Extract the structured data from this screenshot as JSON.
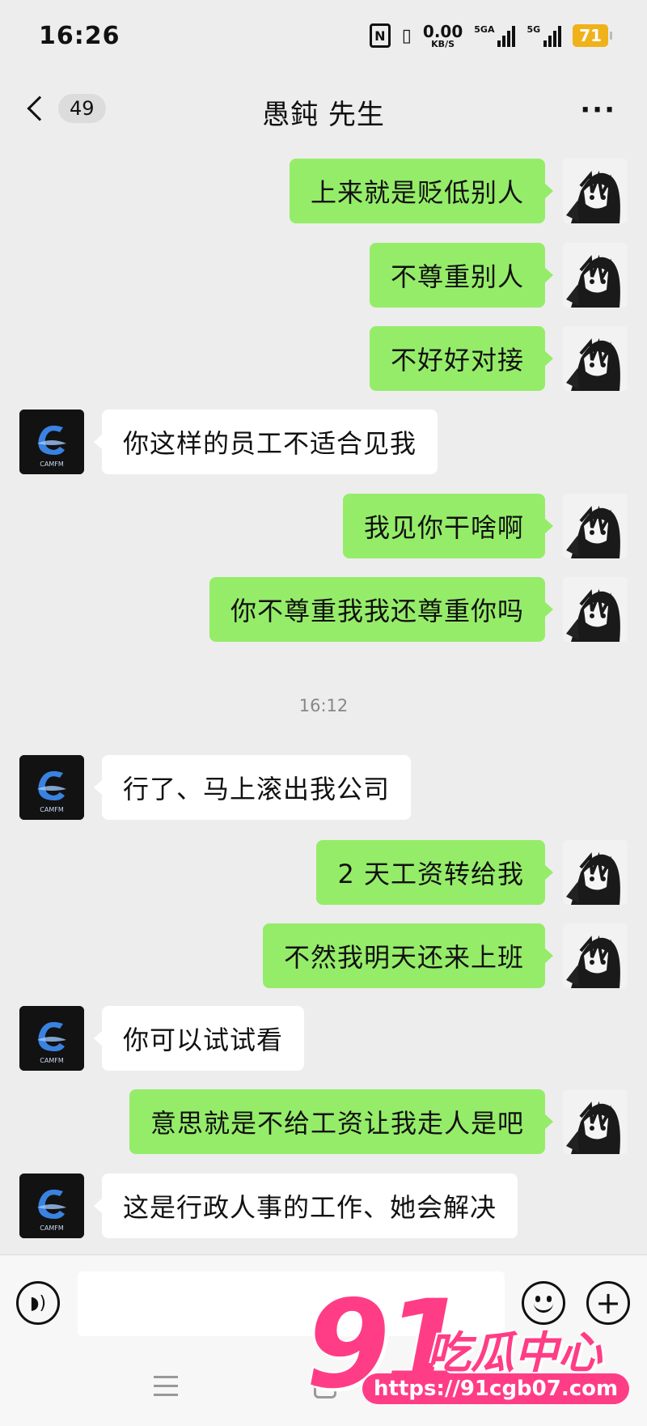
{
  "status_bar": {
    "time": "16:26",
    "nfc": "N",
    "net_speed_value": "0.00",
    "net_speed_unit": "KB/S",
    "sim1_label": "5GA",
    "sim2_label": "5G",
    "battery": "71",
    "icons": [
      "nfc-icon",
      "vibrate-icon",
      "signal-icon",
      "battery-icon"
    ]
  },
  "header": {
    "unread_count": "49",
    "title": "愚鈍 先生",
    "more": "···"
  },
  "messages": [
    {
      "side": "self",
      "text": "上来就是贬低别人"
    },
    {
      "side": "self",
      "text": "不尊重别人"
    },
    {
      "side": "self",
      "text": "不好好对接"
    },
    {
      "side": "other",
      "text": "你这样的员工不适合见我"
    },
    {
      "side": "self",
      "text": "我见你干啥啊"
    },
    {
      "side": "self",
      "text": "你不尊重我我还尊重你吗"
    },
    {
      "side": "other",
      "text": "行了、马上滚出我公司"
    },
    {
      "side": "self",
      "text": "2 天工资转给我"
    },
    {
      "side": "self",
      "text": "不然我明天还来上班"
    },
    {
      "side": "other",
      "text": "你可以试试看"
    },
    {
      "side": "self",
      "text": "意思就是不给工资让我走人是吧"
    },
    {
      "side": "other",
      "text": "这是行政人事的工作、她会解决"
    }
  ],
  "timestamp": "16:12",
  "avatar_other_label": "CAMFM",
  "input_bar": {
    "placeholder": ""
  },
  "watermark": {
    "big": "91",
    "cn": "吃瓜中心",
    "url": "https://91cgb07.com"
  },
  "colors": {
    "self_bubble": "#95ec69",
    "other_bubble": "#ffffff",
    "background": "#ededed",
    "watermark": "#ff3d86"
  }
}
